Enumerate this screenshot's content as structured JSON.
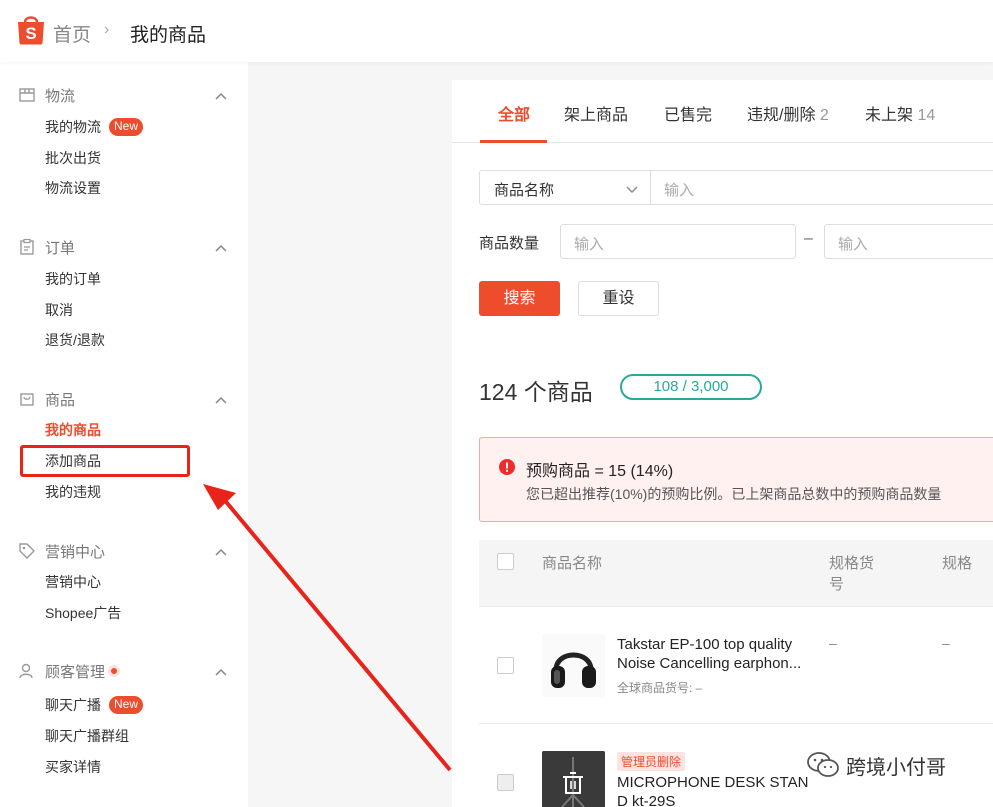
{
  "header": {
    "home": "首页",
    "separator": "›",
    "current": "我的商品"
  },
  "sidebar": {
    "sections": [
      {
        "title": "物流",
        "items": [
          {
            "label": "我的物流",
            "badge": "New"
          },
          {
            "label": "批次出货"
          },
          {
            "label": "物流设置"
          }
        ]
      },
      {
        "title": "订单",
        "items": [
          {
            "label": "我的订单"
          },
          {
            "label": "取消"
          },
          {
            "label": "退货/退款"
          }
        ]
      },
      {
        "title": "商品",
        "items": [
          {
            "label": "我的商品"
          },
          {
            "label": "添加商品"
          },
          {
            "label": "我的违规"
          }
        ]
      },
      {
        "title": "营销中心",
        "items": [
          {
            "label": "营销中心"
          },
          {
            "label": "Shopee广告"
          }
        ]
      },
      {
        "title": "顾客管理",
        "items": [
          {
            "label": "聊天广播",
            "badge": "New"
          },
          {
            "label": "聊天广播群组"
          },
          {
            "label": "买家详情"
          }
        ]
      }
    ]
  },
  "tabs": [
    {
      "label": "全部",
      "count": ""
    },
    {
      "label": "架上商品",
      "count": ""
    },
    {
      "label": "已售完",
      "count": ""
    },
    {
      "label": "违规/删除",
      "count": "2"
    },
    {
      "label": "未上架",
      "count": "14"
    }
  ],
  "filter": {
    "select_value": "商品名称",
    "name_placeholder": "输入",
    "qty_label": "商品数量",
    "qty_min_placeholder": "输入",
    "qty_dash": "–",
    "qty_max_placeholder": "输入",
    "search": "搜索",
    "reset": "重设"
  },
  "summary": {
    "count_title": "124 个商品",
    "quota": "108 / 3,000"
  },
  "alert": {
    "title": "预购商品 = 15 (14%)",
    "desc": "您已超出推荐(10%)的预购比例。已上架商品总数中的预购商品数量"
  },
  "table": {
    "headers": {
      "name": "商品名称",
      "sku_line1": "规格货",
      "sku_line2": "号",
      "variation": "规格"
    },
    "rows": [
      {
        "name_line1": "Takstar EP-100 top quality",
        "name_line2": "Noise Cancelling earphon...",
        "sku": "全球商品货号: –",
        "col_sku": "–",
        "col_var": "–"
      },
      {
        "tag": "管理员删除",
        "name_line1": "MICROPHONE DESK STAN",
        "name_line2": "D kt-29S"
      }
    ]
  },
  "watermark": {
    "text": "跨境小付哥"
  },
  "colors": {
    "brand": "#ee4d2d",
    "teal": "#26aa99",
    "annotation": "#e8231a"
  }
}
